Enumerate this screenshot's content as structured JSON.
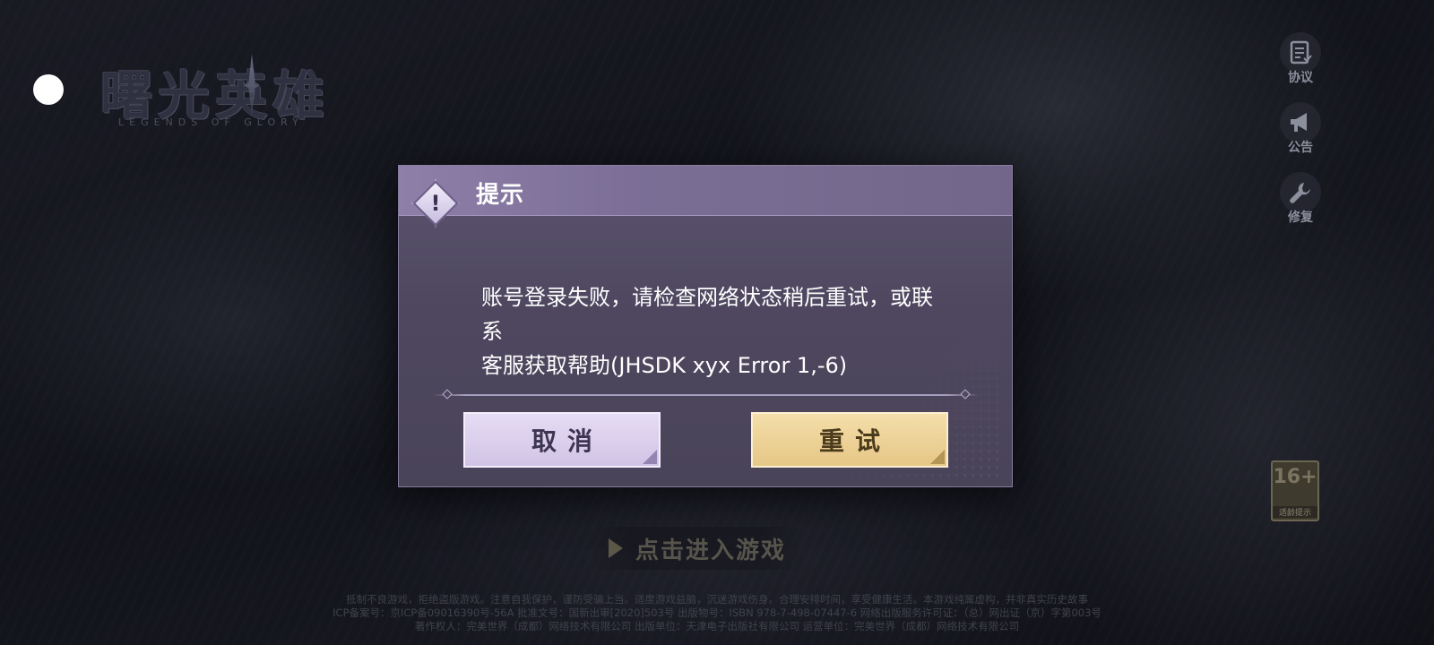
{
  "game": {
    "logo_title": "曙光英雄",
    "logo_subtitle": "LEGENDS OF GLORY"
  },
  "side_menu": [
    {
      "label": "协议",
      "icon": "document-icon"
    },
    {
      "label": "公告",
      "icon": "megaphone-icon"
    },
    {
      "label": "修复",
      "icon": "wrench-icon"
    }
  ],
  "rating": {
    "age": "16+",
    "tip": "适龄提示"
  },
  "enter_game": {
    "label": "点击进入游戏",
    "icon": "play-arrow-icon"
  },
  "footer": {
    "lines": [
      "抵制不良游戏，拒绝盗版游戏。注意自我保护，谨防受骗上当。适度游戏益脑，沉迷游戏伤身。合理安排时间，享受健康生活。本游戏纯属虚构，并非真实历史故事",
      "ICP备案号：京ICP备09016390号-56A  批准文号：国新出审[2020]503号  出版物号：ISBN 978-7-498-07447-6  网络出版服务许可证：（总）网出证（京）字第003号",
      "著作权人：完美世界（成都）网络技术有限公司  出版单位：天津电子出版社有限公司  运营单位：完美世界（成都）网络技术有限公司"
    ]
  },
  "dialog": {
    "title": "提示",
    "icon": "warning-icon",
    "message_line1": "账号登录失败，请检查网络状态稍后重试，或联系",
    "message_line2": "客服获取帮助(JHSDK xyx Error 1,-6)",
    "cancel_label": "取消",
    "retry_label": "重试"
  },
  "colors": {
    "dialog_bg": "#4e475f",
    "dialog_header": "#7b6e95",
    "cancel_button": "#dcd1ee",
    "retry_button": "#eccf90"
  }
}
